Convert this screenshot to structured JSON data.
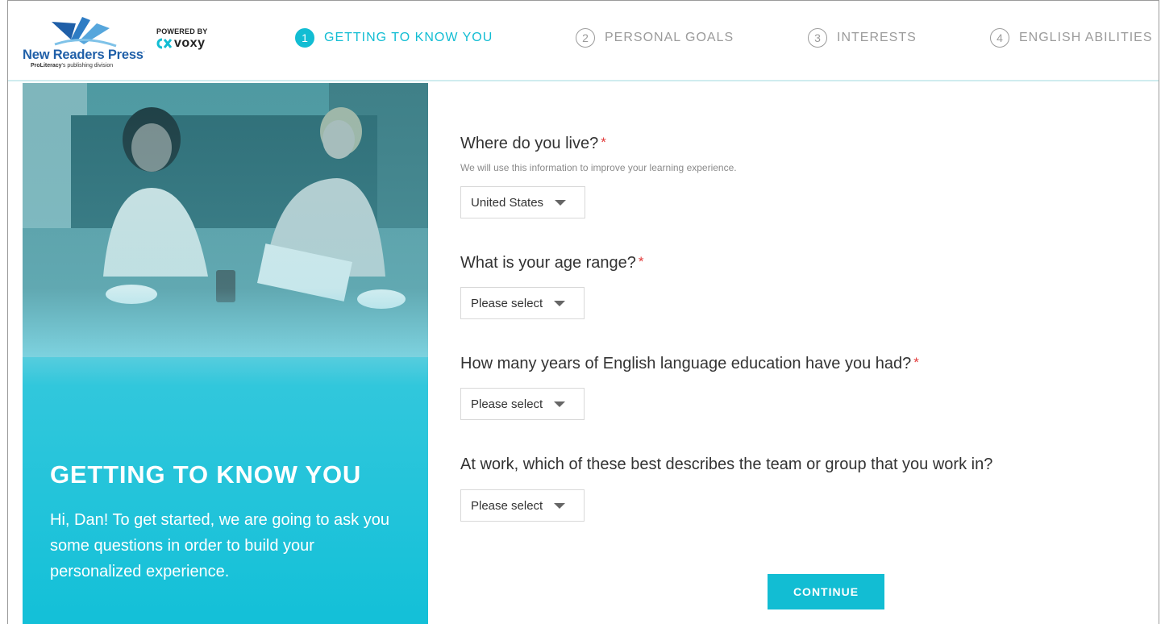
{
  "brand": {
    "name": "New Readers Press",
    "sub_bold": "ProLiteracy",
    "sub_rest": "'s publishing division",
    "powered_by": "POWERED BY",
    "partner": "voxy",
    "accent_color": "#12bdd3",
    "brand_blue": "#1f5fa8"
  },
  "steps": [
    {
      "num": "1",
      "label": "GETTING TO KNOW YOU",
      "active": true
    },
    {
      "num": "2",
      "label": "PERSONAL GOALS",
      "active": false
    },
    {
      "num": "3",
      "label": "INTERESTS",
      "active": false
    },
    {
      "num": "4",
      "label": "ENGLISH ABILITIES",
      "active": false
    }
  ],
  "hero": {
    "title": "GETTING TO KNOW YOU",
    "text": "Hi, Dan! To get started, we are going to ask you some questions in order to build your personalized experience."
  },
  "form": {
    "questions": [
      {
        "label": "Where do you live?",
        "required": true,
        "hint": "We will use this information to improve your learning experience.",
        "selected": "United States"
      },
      {
        "label": "What is your age range?",
        "required": true,
        "selected": "Please select"
      },
      {
        "label": "How many years of English language education have you had?",
        "required": true,
        "selected": "Please select"
      },
      {
        "label": "At work, which of these best describes the team or group that you work in?",
        "required": false,
        "selected": "Please select"
      }
    ],
    "required_marker": "*",
    "continue_label": "CONTINUE"
  }
}
